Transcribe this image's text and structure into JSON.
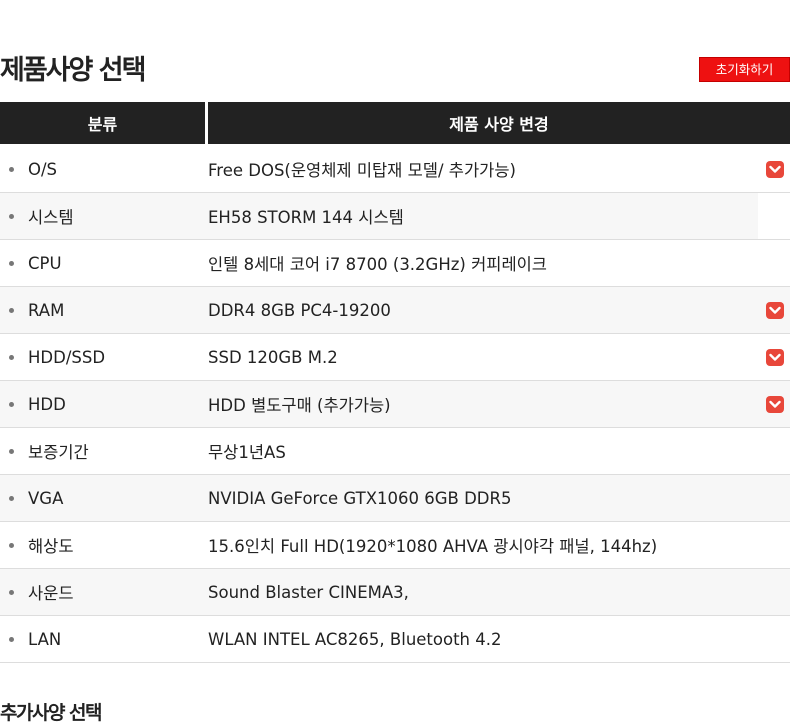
{
  "section_title": "제품사양 선택",
  "reset_button_label": "초기화하기",
  "table": {
    "headers": {
      "category": "분류",
      "spec": "제품 사양 변경"
    },
    "rows": [
      {
        "category": "O/S",
        "value": "Free DOS(운영체제 미탑재 모델/ 추가가능)",
        "has_dropdown": true
      },
      {
        "category": "시스템",
        "value": "EH58 STORM 144 시스템",
        "has_dropdown": false
      },
      {
        "category": "CPU",
        "value": "인텔 8세대 코어 i7 8700 (3.2GHz) 커피레이크",
        "has_dropdown": false
      },
      {
        "category": "RAM",
        "value": "DDR4 8GB PC4-19200",
        "has_dropdown": true
      },
      {
        "category": "HDD/SSD",
        "value": "SSD 120GB M.2",
        "has_dropdown": true
      },
      {
        "category": "HDD",
        "value": "HDD 별도구매 (추가가능)",
        "has_dropdown": true
      },
      {
        "category": "보증기간",
        "value": "무상1년AS",
        "has_dropdown": false
      },
      {
        "category": "VGA",
        "value": "NVIDIA GeForce GTX1060 6GB DDR5",
        "has_dropdown": false
      },
      {
        "category": "해상도",
        "value": "15.6인치 Full HD(1920*1080 AHVA 광시야각 패널, 144hz)",
        "has_dropdown": false
      },
      {
        "category": "사운드",
        "value": "Sound Blaster CINEMA3,",
        "has_dropdown": false
      },
      {
        "category": "LAN",
        "value": "WLAN INTEL AC8265, Bluetooth 4.2",
        "has_dropdown": false
      }
    ]
  },
  "next_section_title": "추가사양 선택",
  "colors": {
    "header_bg": "#222222",
    "accent_red": "#ee1111",
    "dropdown_icon": "#e8473a",
    "row_alt_bg": "#f7f7f7"
  },
  "icons": {
    "dropdown": "chevron-down-icon",
    "bullet": "bullet-dot-icon"
  }
}
